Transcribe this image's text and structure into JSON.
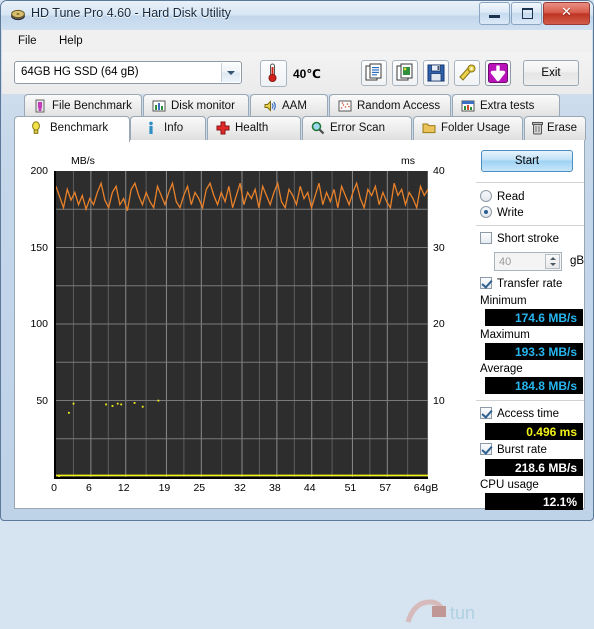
{
  "window": {
    "title": "HD Tune Pro 4.60 - Hard Disk Utility",
    "minimize_label": "Minimize",
    "maximize_label": "Maximize",
    "close_label": "✕"
  },
  "menu": {
    "items": [
      {
        "label": "File",
        "accel": "F"
      },
      {
        "label": "Help",
        "accel": "H"
      }
    ]
  },
  "toolbar": {
    "drive_selected": "64GB HG SSD (64 gB)",
    "temperature": "40℃",
    "thermometer_icon": "thermometer-icon",
    "buttons": [
      {
        "name": "copy-text-button",
        "icon": "copy-text-icon"
      },
      {
        "name": "copy-image-button",
        "icon": "copy-image-icon"
      },
      {
        "name": "save-button",
        "icon": "floppy-disk-icon"
      },
      {
        "name": "settings-button",
        "icon": "tools-icon"
      },
      {
        "name": "download-button",
        "icon": "download-arrow-icon"
      }
    ],
    "exit_label": "Exit"
  },
  "tabs": {
    "row1": [
      {
        "label": "File Benchmark",
        "icon": "file-benchmark-icon",
        "active": false
      },
      {
        "label": "Disk monitor",
        "icon": "bar-chart-icon",
        "active": false
      },
      {
        "label": "AAM",
        "icon": "speaker-icon",
        "active": false
      },
      {
        "label": "Random Access",
        "icon": "scatter-icon",
        "active": false
      },
      {
        "label": "Extra tests",
        "icon": "extra-tests-icon",
        "active": false
      }
    ],
    "row2": [
      {
        "label": "Benchmark",
        "icon": "bulb-icon",
        "active": true
      },
      {
        "label": "Info",
        "icon": "info-icon",
        "active": false
      },
      {
        "label": "Health",
        "icon": "health-cross-icon",
        "active": false
      },
      {
        "label": "Error Scan",
        "icon": "magnifier-icon",
        "active": false
      },
      {
        "label": "Folder Usage",
        "icon": "folder-icon",
        "active": false
      },
      {
        "label": "Erase",
        "icon": "trash-icon",
        "active": false
      }
    ]
  },
  "panel": {
    "start_label": "Start",
    "mode_options": [
      {
        "label": "Read",
        "selected": false
      },
      {
        "label": "Write",
        "selected": true
      }
    ],
    "short_stroke": {
      "label": "Short stroke",
      "checked": false,
      "value": "40",
      "unit": "gB"
    },
    "transfer_rate": {
      "label": "Transfer rate",
      "checked": true
    },
    "stats": [
      {
        "label": "Minimum",
        "value": "174.6 MB/s",
        "color": "#27b6f0"
      },
      {
        "label": "Maximum",
        "value": "193.3 MB/s",
        "color": "#27b6f0"
      },
      {
        "label": "Average",
        "value": "184.8 MB/s",
        "color": "#27b6f0"
      }
    ],
    "access_time": {
      "label": "Access time",
      "checked": true,
      "value": "0.496 ms",
      "color": "#f2f219"
    },
    "burst_rate": {
      "label": "Burst rate",
      "checked": true,
      "value": "218.6 MB/s",
      "color": "#ffffff"
    },
    "cpu_usage": {
      "label": "CPU usage",
      "value": "12.1%",
      "color": "#ffffff"
    }
  },
  "chart_data": {
    "type": "line",
    "title": "",
    "ylabel": "MB/s",
    "ylabel_right": "ms",
    "xlabel": "",
    "x_ticks": [
      "0",
      "6",
      "12",
      "19",
      "25",
      "32",
      "38",
      "44",
      "51",
      "57",
      "64gB"
    ],
    "x_tick_values": [
      0,
      6,
      12,
      19,
      25,
      32,
      38,
      44,
      51,
      57,
      64
    ],
    "y_ticks_left": [
      "200",
      "150",
      "100",
      "50"
    ],
    "y_tick_values_left": [
      200,
      150,
      100,
      50
    ],
    "y_ticks_right": [
      "40",
      "30",
      "20",
      "10"
    ],
    "y_tick_values_right": [
      40,
      30,
      20,
      10
    ],
    "ylim": [
      0,
      200
    ],
    "ylim_right": [
      0,
      40
    ],
    "xlim": [
      0,
      64
    ],
    "grid": true,
    "background": "#2d2d2d",
    "series": [
      {
        "name": "Transfer rate",
        "color": "#e8812a",
        "axis": "left",
        "units": "MB/s",
        "values": [
          190,
          183,
          176,
          188,
          181,
          186,
          178,
          184,
          175,
          182,
          178,
          186,
          192,
          181,
          176,
          186,
          190,
          178,
          182,
          174,
          188,
          192,
          184,
          178,
          186,
          180,
          176,
          190,
          184,
          178,
          186,
          192,
          180,
          176,
          184,
          190,
          178,
          186,
          182,
          176,
          188,
          192,
          184,
          178,
          186,
          180,
          190,
          176,
          184,
          192,
          178,
          186,
          182,
          188,
          176,
          190,
          184,
          178,
          186,
          192,
          180,
          176,
          188,
          184,
          178,
          190,
          182,
          186,
          176,
          184,
          192,
          178,
          186,
          180,
          188,
          176,
          190,
          184,
          178,
          186,
          192,
          182,
          176,
          188,
          184,
          190,
          178,
          186,
          180,
          176,
          192,
          184,
          188,
          178,
          186,
          182,
          176,
          190,
          184,
          188
        ]
      },
      {
        "name": "Access time",
        "color": "#f2f219",
        "axis": "right",
        "units": "ms",
        "points": [
          {
            "x": 2.2,
            "y": 8.4
          },
          {
            "x": 3.0,
            "y": 9.6
          },
          {
            "x": 8.6,
            "y": 9.5
          },
          {
            "x": 9.7,
            "y": 9.3
          },
          {
            "x": 10.6,
            "y": 9.6
          },
          {
            "x": 11.2,
            "y": 9.5
          },
          {
            "x": 13.5,
            "y": 9.7
          },
          {
            "x": 14.9,
            "y": 9.2
          },
          {
            "x": 17.6,
            "y": 10.0
          },
          {
            "x": 0.5,
            "y": 0.1
          }
        ]
      },
      {
        "name": "Baseline",
        "color": "#f2f219",
        "axis": "left",
        "units": "MB/s",
        "constant": 1
      }
    ]
  }
}
